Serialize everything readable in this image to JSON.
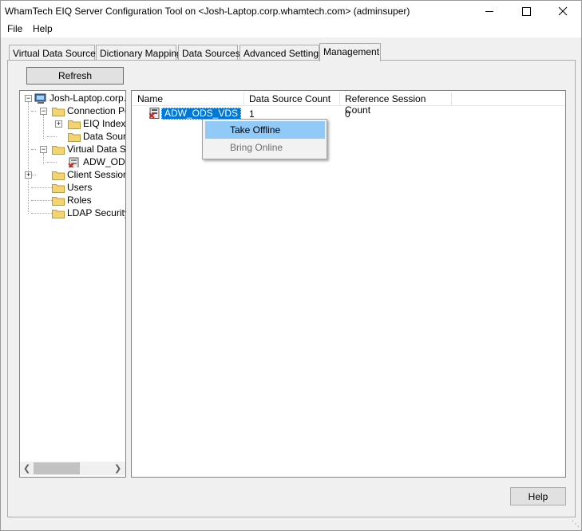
{
  "window": {
    "title": "WhamTech EIQ Server Configuration Tool on <Josh-Laptop.corp.whamtech.com> (adminsuper)"
  },
  "menu": [
    "File",
    "Help"
  ],
  "tabs": [
    {
      "label": "Virtual Data Sources",
      "active": false
    },
    {
      "label": "Dictionary Mapping",
      "active": false
    },
    {
      "label": "Data Sources",
      "active": false
    },
    {
      "label": "Advanced Settings",
      "active": false
    },
    {
      "label": "Management",
      "active": true
    }
  ],
  "refresh_label": "Refresh",
  "tree": {
    "root": "Josh-Laptop.corp.w",
    "connection_pools": "Connection Pc",
    "eiq_indexes": "EIQ Indexé",
    "data_sources": "Data Sour",
    "virtual_data_sources": "Virtual Data Sc",
    "adw_od": "ADW_OD",
    "client_sessions": "Client Sessions",
    "users": "Users",
    "roles": "Roles",
    "ldap_security": "LDAP Security"
  },
  "list": {
    "columns": [
      "Name",
      "Data Source Count",
      "Reference Session Count"
    ],
    "rows": [
      {
        "name": "ADW_ODS_VDS",
        "data_source_count": "1",
        "reference_session_count": "0"
      }
    ]
  },
  "context_menu": {
    "take_offline": "Take Offline",
    "bring_online": "Bring Online"
  },
  "help_label": "Help",
  "colors": {
    "selection": "#0078d7",
    "menu_highlight": "#91c9f7",
    "folder": "#f3d46e"
  }
}
